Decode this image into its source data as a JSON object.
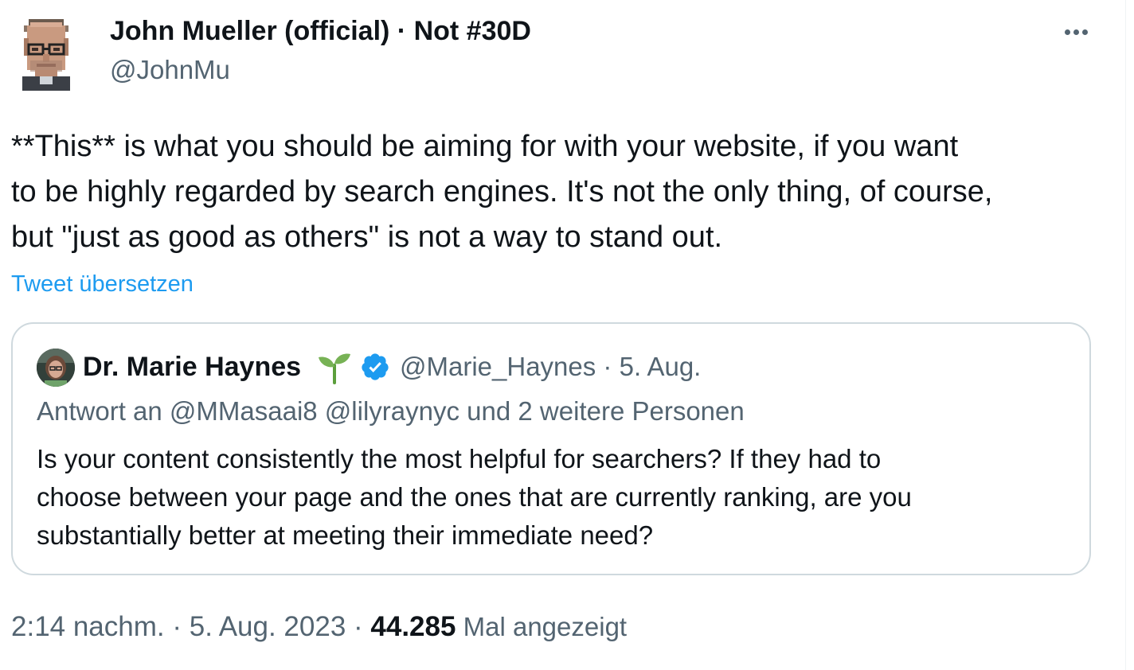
{
  "author": {
    "name": "John Mueller (official) · Not #30D",
    "handle": "@JohnMu",
    "avatar_icon": "pixel-portrait-avatar"
  },
  "more_icon": "more-dots-icon",
  "tweet": {
    "text": "**This** is what you should be aiming for with your website, if you want\nto be highly regarded by search engines. It's not the only thing, of course,\nbut \"just as good as others\" is not a way to stand out.",
    "translate_label": "Tweet übersetzen"
  },
  "quote": {
    "author_name": "Dr. Marie Haynes",
    "handle_date": "@Marie_Haynes · 5. Aug.",
    "reply_to": "Antwort an @MMasaai8 @lilyraynyc und 2 weitere Personen",
    "text": "Is your content consistently the most helpful for searchers? If they had to\nchoose between your page and the ones that are currently ranking, are you\nsubstantially better at meeting their immediate need?",
    "sprout_icon": "seedling-icon",
    "verified_icon": "verified-badge-icon",
    "verified_color": "#1d9bf0"
  },
  "meta": {
    "timestamp": "2:14 nachm. · 5. Aug. 2023 · ",
    "views_count": "44.285",
    "views_label": " Mal angezeigt"
  },
  "colors": {
    "text": "#0f1419",
    "secondary": "#536471",
    "link": "#1d9bf0",
    "border": "#cfd9de"
  }
}
